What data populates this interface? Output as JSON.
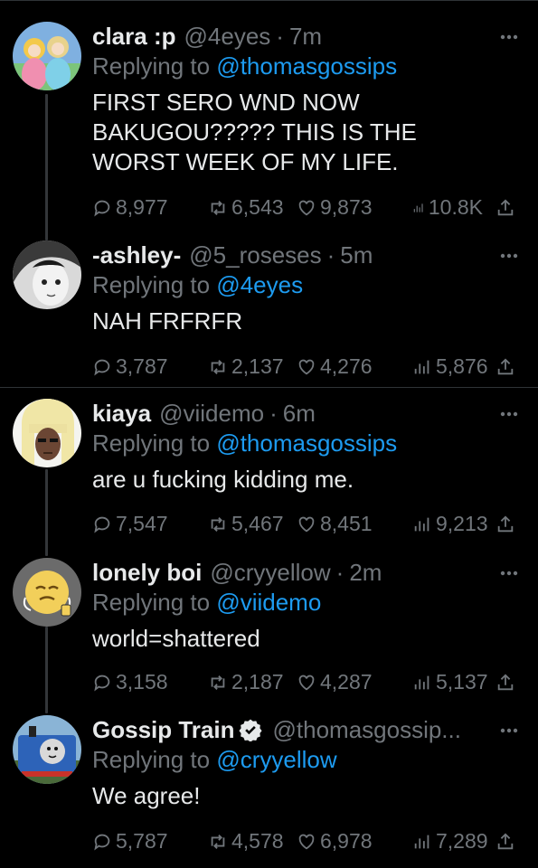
{
  "colors": {
    "background": "#000000",
    "text": "#e7e9ea",
    "muted": "#71767b",
    "link": "#1d9bf0",
    "divider": "#2f3336"
  },
  "tweets": [
    {
      "name": "clara :p",
      "handle": "@4eyes",
      "sep": "·",
      "time": "7m",
      "replying_prefix": "Replying to",
      "replying_to": "@thomasgossips",
      "text_lines": [
        "FIRST SERO WND NOW",
        "BAKUGOU????? THIS IS THE",
        "WORST WEEK OF MY LIFE."
      ],
      "replies": "8,977",
      "retweets": "6,543",
      "likes": "9,873",
      "views": "10.8K",
      "avatar_icon": "anime-princess-avatar"
    },
    {
      "name": "-ashley-",
      "handle": "@5_roseses",
      "sep": "·",
      "time": "5m",
      "replying_prefix": "Replying to",
      "replying_to": "@4eyes",
      "text_lines": [
        "NAH FRFRFR"
      ],
      "replies": "3,787",
      "retweets": "2,137",
      "likes": "4,276",
      "views": "5,876",
      "avatar_icon": "monochrome-anime-avatar"
    },
    {
      "name": "kiaya",
      "handle": "@viidemo",
      "sep": "·",
      "time": "6m",
      "replying_prefix": "Replying to",
      "replying_to": "@thomasgossips",
      "text_lines": [
        "are u fucking kidding me."
      ],
      "replies": "7,547",
      "retweets": "5,467",
      "likes": "8,451",
      "views": "9,213",
      "avatar_icon": "blonde-wig-avatar"
    },
    {
      "name": "lonely boi",
      "handle": "@cryyellow",
      "sep": "·",
      "time": "2m",
      "replying_prefix": "Replying to",
      "replying_to": "@viidemo",
      "text_lines": [
        "world=shattered"
      ],
      "replies": "3,158",
      "retweets": "2,187",
      "likes": "4,287",
      "views": "5,137",
      "avatar_icon": "yellow-emoji-avatar"
    },
    {
      "name": "Gossip Train",
      "handle": "@thomasgossip...",
      "sep": "",
      "time": "",
      "verified": true,
      "replying_prefix": "Replying to",
      "replying_to": "@cryyellow",
      "text_lines": [
        "We agree!"
      ],
      "replies": "5,787",
      "retweets": "4,578",
      "likes": "6,978",
      "views": "7,289",
      "avatar_icon": "blue-train-avatar"
    }
  ]
}
